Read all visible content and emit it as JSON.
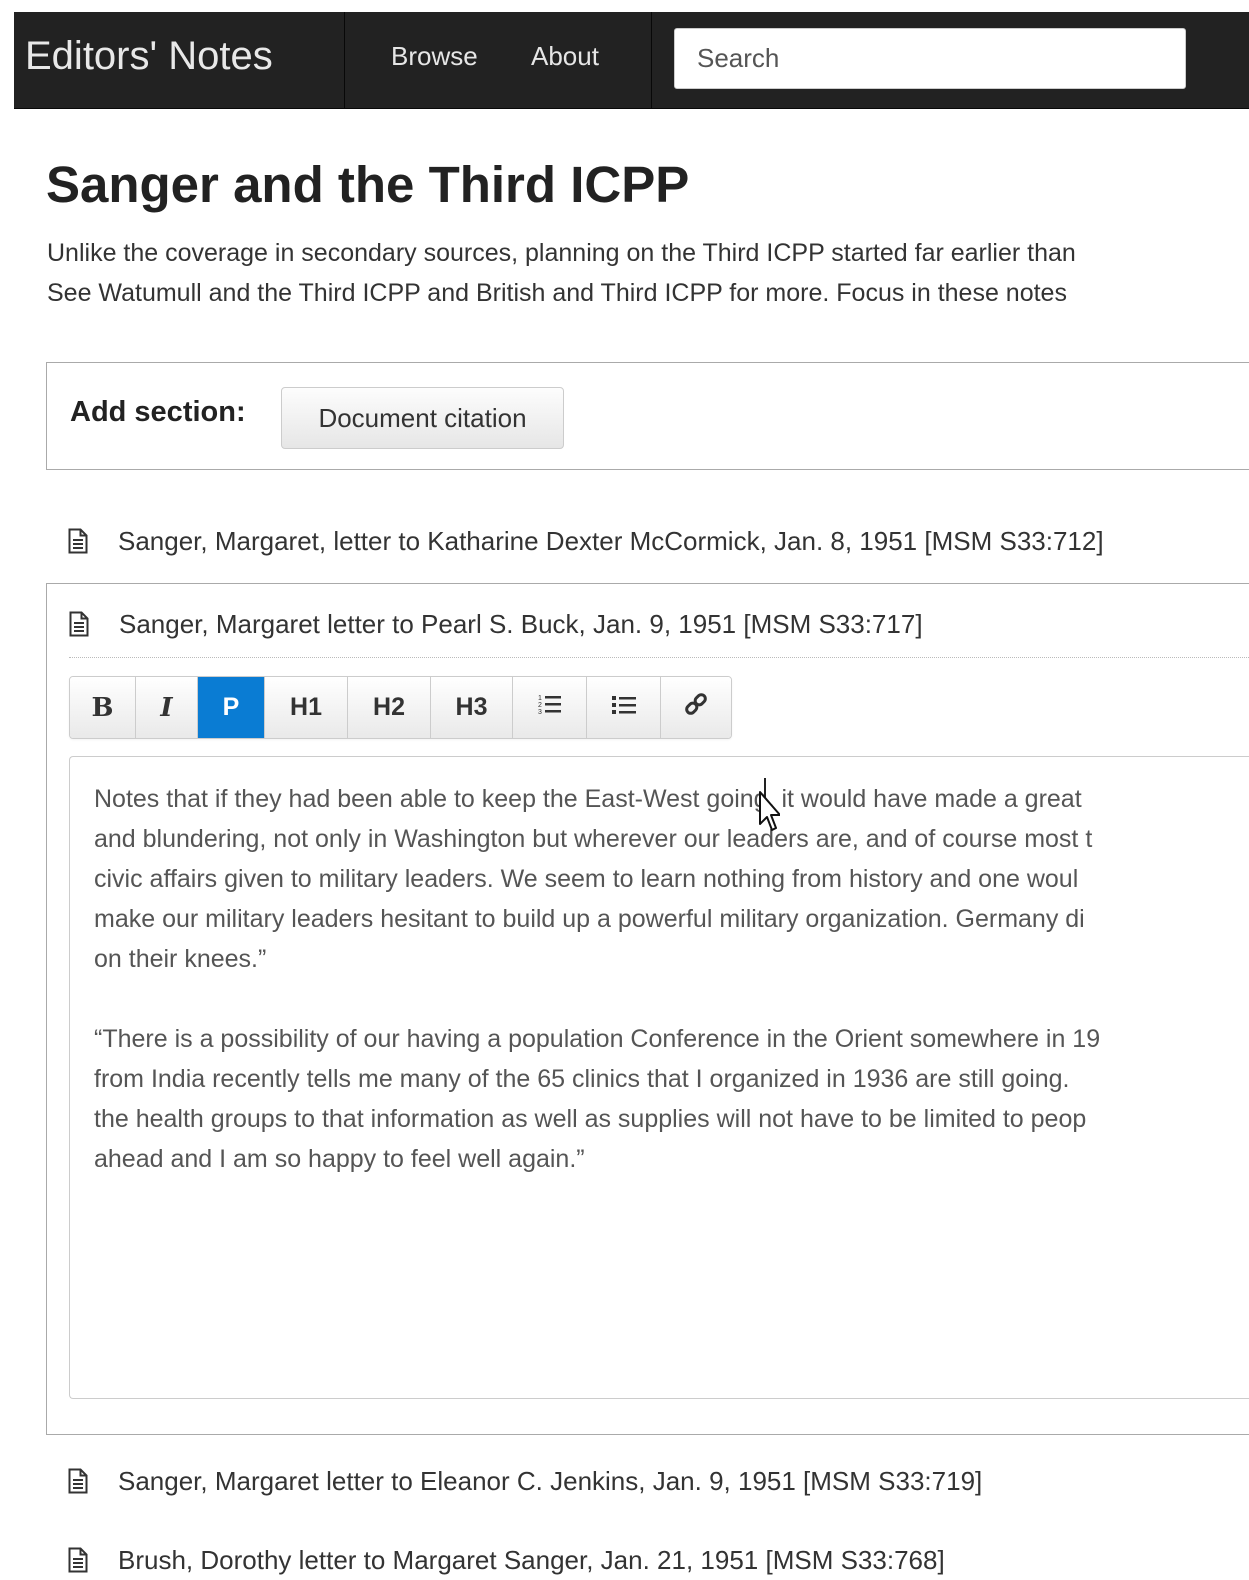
{
  "navbar": {
    "brand": "Editors' Notes",
    "links": [
      "Browse",
      "About"
    ],
    "search_placeholder": "Search"
  },
  "page": {
    "title": "Sanger and the Third ICPP",
    "intro_lines": [
      "Unlike the coverage in secondary sources, planning on the Third ICPP started far earlier than",
      "See Watumull and the Third ICPP and British and Third ICPP for more.  Focus in these notes"
    ]
  },
  "add_section": {
    "label": "Add section:",
    "document_citation_button": "Document citation"
  },
  "documents": {
    "doc_1": "Sanger, Margaret, letter to Katharine Dexter McCormick, Jan. 8, 1951 [MSM S33:712]",
    "doc_2": "Sanger, Margaret letter to Pearl S. Buck, Jan. 9, 1951 [MSM S33:717]",
    "doc_3": "Sanger, Margaret letter to Eleanor C. Jenkins, Jan. 9, 1951 [MSM S33:719]",
    "doc_4": "Brush, Dorothy letter to Margaret Sanger, Jan. 21, 1951 [MSM S33:768]"
  },
  "toolbar": {
    "bold": "B",
    "italic": "I",
    "paragraph": "P",
    "h1": "H1",
    "h2": "H2",
    "h3": "H3",
    "active": "P"
  },
  "editor": {
    "paragraph_1": [
      "Notes that if they had been able to keep the East-West going, it would have made a great",
      "and blundering, not only in Washington but wherever our leaders are, and of course most t",
      "civic affairs given to military leaders. We seem to learn nothing from history and one woul",
      "make our military leaders hesitant to build up a powerful military organization. Germany di",
      "on their knees.”"
    ],
    "paragraph_2": [
      "“There is a possibility of our having a population Conference in the Orient somewhere in 19",
      "from India recently tells me many of the 65 clinics that I organized in 1936 are still going.",
      "the health groups to that information as well as supplies will not have to be limited to peop",
      "ahead and I am so happy to feel well again.”"
    ]
  },
  "colors": {
    "navbar_bg": "#222222",
    "active_button": "#0a7cd3"
  }
}
